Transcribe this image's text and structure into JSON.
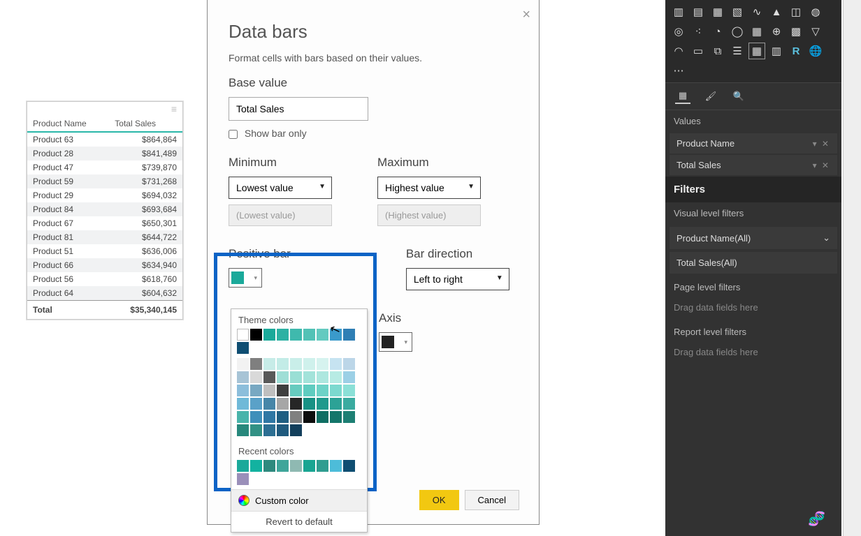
{
  "table": {
    "col1": "Product Name",
    "col2": "Total Sales",
    "rows": [
      {
        "name": "Product 63",
        "val": "$864,864"
      },
      {
        "name": "Product 28",
        "val": "$841,489"
      },
      {
        "name": "Product 47",
        "val": "$739,870"
      },
      {
        "name": "Product 59",
        "val": "$731,268"
      },
      {
        "name": "Product 29",
        "val": "$694,032"
      },
      {
        "name": "Product 84",
        "val": "$693,684"
      },
      {
        "name": "Product 67",
        "val": "$650,301"
      },
      {
        "name": "Product 81",
        "val": "$644,722"
      },
      {
        "name": "Product 51",
        "val": "$636,006"
      },
      {
        "name": "Product 66",
        "val": "$634,940"
      },
      {
        "name": "Product 56",
        "val": "$618,760"
      },
      {
        "name": "Product 64",
        "val": "$604,632"
      }
    ],
    "total_label": "Total",
    "total_val": "$35,340,145"
  },
  "modal": {
    "title": "Data bars",
    "subtitle": "Format cells with bars based on their values.",
    "base_value_label": "Base value",
    "base_value_field": "Total Sales",
    "show_bar_only_label": "Show bar only",
    "min_label": "Minimum",
    "max_label": "Maximum",
    "min_sel": "Lowest value",
    "max_sel": "Highest value",
    "min_ph": "(Lowest value)",
    "max_ph": "(Highest value)",
    "positive_bar_label": "Positive bar",
    "bar_direction_label": "Bar direction",
    "bar_direction_sel": "Left to right",
    "axis_label": "Axis",
    "ok": "OK",
    "cancel": "Cancel",
    "positive_color": "#1aa99a",
    "axis_color": "#222222"
  },
  "palette": {
    "theme_label": "Theme colors",
    "recent_label": "Recent colors",
    "custom_label": "Custom color",
    "revert_label": "Revert to default",
    "theme_row": [
      "#ffffff",
      "#000000",
      "#1aa99a",
      "#2db1a3",
      "#3fb9ad",
      "#52c2b6",
      "#64cac0",
      "#3a9acb",
      "#2f7fb5",
      "#0f4e72"
    ],
    "theme_shades": [
      [
        "#f2f2f2",
        "#7f7f7f",
        "#c7ece8",
        "#c3ece7",
        "#c9eee9",
        "#cff1ec",
        "#d6f3ef",
        "#c6e3f1",
        "#bcd6e8",
        "#a7c4d6"
      ],
      [
        "#d9d9d9",
        "#595959",
        "#9fded6",
        "#9adfd5",
        "#a3e3da",
        "#ade7df",
        "#b7ebe4",
        "#9cd0e6",
        "#8cbedb",
        "#78a8c2"
      ],
      [
        "#bfbfbf",
        "#3f3f3f",
        "#66cbbf",
        "#5fccc0",
        "#6dd2c7",
        "#7cd9cf",
        "#8be0d7",
        "#6fb9d8",
        "#5aa1c8",
        "#4786a8"
      ],
      [
        "#a6a6a6",
        "#262626",
        "#179184",
        "#1f998c",
        "#2ca296",
        "#3aaba0",
        "#49b4aa",
        "#3f8fba",
        "#2f77a4",
        "#1f5e82"
      ],
      [
        "#808080",
        "#0d0d0d",
        "#0f6e63",
        "#14766a",
        "#1d7f73",
        "#27887c",
        "#329185",
        "#2c6f93",
        "#1f5a7e",
        "#133f5c"
      ]
    ],
    "recent_row": [
      "#1aa99a",
      "#13b2a0",
      "#2e8a7e",
      "#3fa59a",
      "#8fb9b2",
      "#19a592",
      "#2f9d90",
      "#4dbcd9",
      "#0f4e72",
      "#9a8fb9"
    ]
  },
  "rpanel": {
    "values_label": "Values",
    "field1": "Product Name",
    "field2": "Total Sales",
    "filters_label": "Filters",
    "visual_filters_label": "Visual level filters",
    "vf1": "Product Name(All)",
    "vf2": "Total Sales(All)",
    "page_filters_label": "Page level filters",
    "drag_hint": "Drag data fields here",
    "report_filters_label": "Report level filters"
  }
}
